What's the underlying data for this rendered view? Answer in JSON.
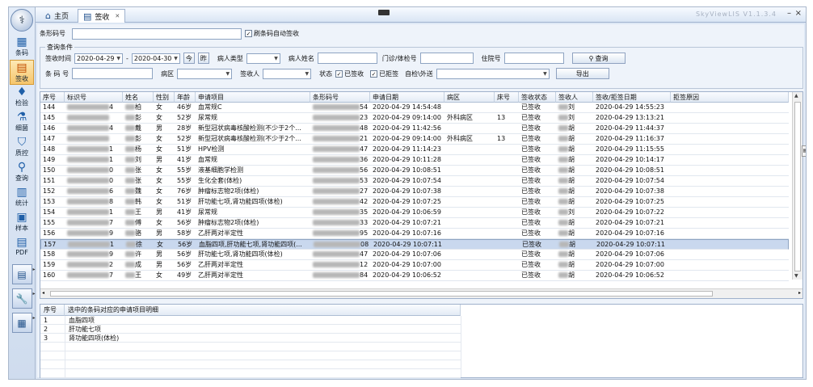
{
  "window": {
    "title": "SkyViewLIS  V1.1.3.4",
    "min": "–",
    "close": "×"
  },
  "nav": [
    {
      "name": "barcode",
      "label": "条码",
      "icon": "▦"
    },
    {
      "name": "sign",
      "label": "签收",
      "icon": "▤"
    },
    {
      "name": "inspect",
      "label": "检验",
      "icon": "♦"
    },
    {
      "name": "bacteria",
      "label": "细菌",
      "icon": "⚗"
    },
    {
      "name": "quality",
      "label": "质控",
      "icon": "⛉"
    },
    {
      "name": "query",
      "label": "查询",
      "icon": "⚲"
    },
    {
      "name": "stats",
      "label": "统计",
      "icon": "▥"
    },
    {
      "name": "sample",
      "label": "样本",
      "icon": "▣"
    },
    {
      "name": "pdf",
      "label": "PDF",
      "icon": "▤"
    }
  ],
  "tabs": {
    "home": "主页",
    "sign": "签收"
  },
  "barcode": {
    "label": "条形码号",
    "auto": "刷条码自动签收"
  },
  "cond": {
    "legend": "查询条件",
    "sign_time": "签收时间",
    "date_from": "2020-04-29",
    "date_to": "2020-04-30",
    "today": "今",
    "yesterday": "昨",
    "patient_type": "病人类型",
    "patient_name": "病人姓名",
    "clinic_no": "门诊/体检号",
    "inpatient_no": "住院号",
    "query": "查询",
    "barcode_no": "条 码 号",
    "ward": "病区",
    "signer": "签收人",
    "status": "状态",
    "signed": "已签收",
    "rejected": "已拒签",
    "self_send": "自检\\外送",
    "export": "导出"
  },
  "columns": [
    "序号",
    "标识号",
    "姓名",
    "性别",
    "年龄",
    "申请项目",
    "条形码号",
    "申请日期",
    "病区",
    "床号",
    "签收状态",
    "签收人",
    "签收/拒签日期",
    "拒签原因"
  ],
  "rows": [
    {
      "no": "144",
      "id": "4",
      "name": "柏",
      "sex": "女",
      "age": "46岁",
      "item": "血常规C",
      "bc": "54",
      "date": "2020-04-29 14:54:48",
      "ward": "",
      "bed": "",
      "status": "已签收",
      "signer": "刘",
      "sdate": "2020-04-29 14:55:23"
    },
    {
      "no": "145",
      "id": "",
      "name": "彭",
      "sex": "女",
      "age": "52岁",
      "item": "尿常规",
      "bc": "23",
      "date": "2020-04-29 09:14:00",
      "ward": "外科病区",
      "bed": "13",
      "status": "已签收",
      "signer": "刘",
      "sdate": "2020-04-29 13:13:21"
    },
    {
      "no": "146",
      "id": "4",
      "name": "戴",
      "sex": "男",
      "age": "28岁",
      "item": "新型冠状病毒核酸检测(不少于2个...",
      "bc": "48",
      "date": "2020-04-29 11:42:56",
      "ward": "",
      "bed": "",
      "status": "已签收",
      "signer": "胡",
      "sdate": "2020-04-29 11:44:37"
    },
    {
      "no": "147",
      "id": "",
      "name": "彭",
      "sex": "女",
      "age": "52岁",
      "item": "新型冠状病毒核酸检测(不少于2个...",
      "bc": "21",
      "date": "2020-04-29 09:14:00",
      "ward": "外科病区",
      "bed": "13",
      "status": "已签收",
      "signer": "胡",
      "sdate": "2020-04-29 11:16:37"
    },
    {
      "no": "148",
      "id": "1",
      "name": "杨",
      "sex": "女",
      "age": "51岁",
      "item": "HPV检测",
      "bc": "47",
      "date": "2020-04-29 11:14:23",
      "ward": "",
      "bed": "",
      "status": "已签收",
      "signer": "胡",
      "sdate": "2020-04-29 11:15:55"
    },
    {
      "no": "149",
      "id": "1",
      "name": "刘",
      "sex": "男",
      "age": "41岁",
      "item": "血常规",
      "bc": "36",
      "date": "2020-04-29 10:11:28",
      "ward": "",
      "bed": "",
      "status": "已签收",
      "signer": "胡",
      "sdate": "2020-04-29 10:14:17"
    },
    {
      "no": "150",
      "id": "0",
      "name": "张",
      "sex": "女",
      "age": "55岁",
      "item": "液基细胞学检测",
      "bc": "56",
      "date": "2020-04-29 10:08:51",
      "ward": "",
      "bed": "",
      "status": "已签收",
      "signer": "胡",
      "sdate": "2020-04-29 10:08:51"
    },
    {
      "no": "151",
      "id": "0",
      "name": "张",
      "sex": "女",
      "age": "55岁",
      "item": "生化全套(体检)",
      "bc": "53",
      "date": "2020-04-29 10:07:54",
      "ward": "",
      "bed": "",
      "status": "已签收",
      "signer": "胡",
      "sdate": "2020-04-29 10:07:54"
    },
    {
      "no": "152",
      "id": "6",
      "name": "魏",
      "sex": "女",
      "age": "76岁",
      "item": "肿瘤标志物2项(体检)",
      "bc": "27",
      "date": "2020-04-29 10:07:38",
      "ward": "",
      "bed": "",
      "status": "已签收",
      "signer": "胡",
      "sdate": "2020-04-29 10:07:38"
    },
    {
      "no": "153",
      "id": "8",
      "name": "韩",
      "sex": "女",
      "age": "51岁",
      "item": "肝功能七项,肾功能四项(体检)",
      "bc": "42",
      "date": "2020-04-29 10:07:25",
      "ward": "",
      "bed": "",
      "status": "已签收",
      "signer": "胡",
      "sdate": "2020-04-29 10:07:25"
    },
    {
      "no": "154",
      "id": "1",
      "name": "王",
      "sex": "男",
      "age": "41岁",
      "item": "尿常规",
      "bc": "35",
      "date": "2020-04-29 10:06:59",
      "ward": "",
      "bed": "",
      "status": "已签收",
      "signer": "刘",
      "sdate": "2020-04-29 10:07:22"
    },
    {
      "no": "155",
      "id": "7",
      "name": "傅",
      "sex": "女",
      "age": "56岁",
      "item": "肿瘤标志物2项(体检)",
      "bc": "33",
      "date": "2020-04-29 10:07:21",
      "ward": "",
      "bed": "",
      "status": "已签收",
      "signer": "胡",
      "sdate": "2020-04-29 10:07:21"
    },
    {
      "no": "156",
      "id": "9",
      "name": "骆",
      "sex": "男",
      "age": "58岁",
      "item": "乙肝两对半定性",
      "bc": "95",
      "date": "2020-04-29 10:07:16",
      "ward": "",
      "bed": "",
      "status": "已签收",
      "signer": "胡",
      "sdate": "2020-04-29 10:07:16"
    },
    {
      "no": "157",
      "id": "1",
      "name": "徐",
      "sex": "女",
      "age": "56岁",
      "item": "血脂四项,肝功能七项,肾功能四项(...",
      "bc": "08",
      "date": "2020-04-29 10:07:11",
      "ward": "",
      "bed": "",
      "status": "已签收",
      "signer": "胡",
      "sdate": "2020-04-29 10:07:11"
    },
    {
      "no": "158",
      "id": "9",
      "name": "许",
      "sex": "男",
      "age": "56岁",
      "item": "肝功能七项,肾功能四项(体检)",
      "bc": "47",
      "date": "2020-04-29 10:07:06",
      "ward": "",
      "bed": "",
      "status": "已签收",
      "signer": "胡",
      "sdate": "2020-04-29 10:07:06"
    },
    {
      "no": "159",
      "id": "2",
      "name": "成",
      "sex": "男",
      "age": "56岁",
      "item": "乙肝两对半定性",
      "bc": "12",
      "date": "2020-04-29 10:07:00",
      "ward": "",
      "bed": "",
      "status": "已签收",
      "signer": "胡",
      "sdate": "2020-04-29 10:07:00"
    },
    {
      "no": "160",
      "id": "7",
      "name": "王",
      "sex": "女",
      "age": "49岁",
      "item": "乙肝两对半定性",
      "bc": "84",
      "date": "2020-04-29 10:06:52",
      "ward": "",
      "bed": "",
      "status": "已签收",
      "signer": "胡",
      "sdate": "2020-04-29 10:06:52"
    }
  ],
  "detail": {
    "columns": [
      "序号",
      "选中的条码对应的申请项目明细"
    ],
    "rows": [
      {
        "no": "1",
        "item": "血脂四项"
      },
      {
        "no": "2",
        "item": "肝功能七项"
      },
      {
        "no": "3",
        "item": "肾功能四项(体检)"
      }
    ]
  }
}
